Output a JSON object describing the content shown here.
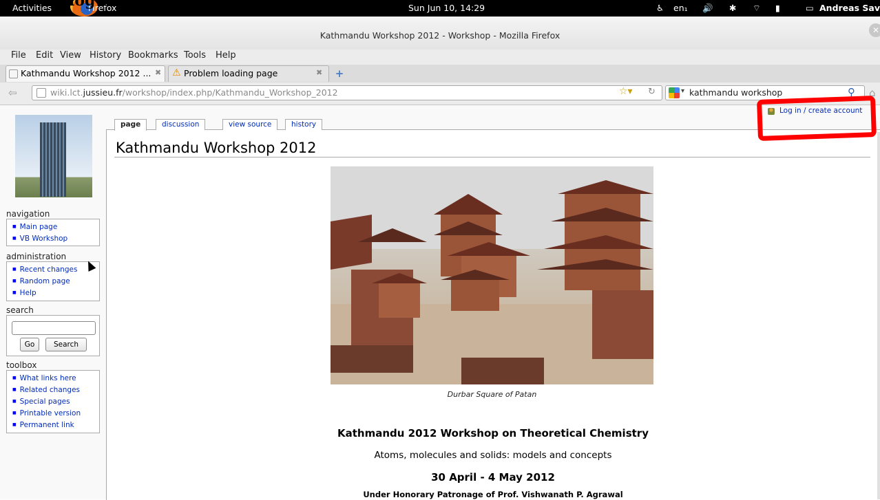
{
  "annotation": "log in",
  "top_panel": {
    "activities": "Activities",
    "app": "Firefox",
    "clock": "Sun Jun 10, 14:29",
    "keyboard": "en₁",
    "user": "Andreas Savin",
    "icons": [
      "accessibility-icon",
      "volume-icon",
      "bluetooth-icon",
      "wifi-icon",
      "battery-icon",
      "chat-icon"
    ]
  },
  "window": {
    "title": "Kathmandu Workshop 2012 - Workshop - Mozilla Firefox"
  },
  "menu": [
    "File",
    "Edit",
    "View",
    "History",
    "Bookmarks",
    "Tools",
    "Help"
  ],
  "tabs": [
    {
      "label": "Kathmandu Workshop 2012 ...",
      "active": true
    },
    {
      "label": "Problem loading page",
      "active": false
    }
  ],
  "nav": {
    "url_prefix": "wiki.lct.",
    "url_domain": "jussieu.fr",
    "url_path": "/workshop/index.php/Kathmandu_Workshop_2012",
    "search_value": "kathmandu workshop"
  },
  "sidebar": {
    "navigation": {
      "title": "navigation",
      "items": [
        "Main page",
        "VB Workshop"
      ]
    },
    "administration": {
      "title": "administration",
      "items": [
        "Recent changes",
        "Random page",
        "Help"
      ]
    },
    "search": {
      "title": "search",
      "go": "Go",
      "search": "Search"
    },
    "toolbox": {
      "title": "toolbox",
      "items": [
        "What links here",
        "Related changes",
        "Special pages",
        "Printable version",
        "Permanent link"
      ]
    }
  },
  "page_tabs": [
    "page",
    "discussion",
    "view source",
    "history"
  ],
  "login": "Log in / create account",
  "content": {
    "title": "Kathmandu Workshop 2012",
    "caption": "Durbar Square of Patan",
    "heading": "Kathmandu 2012 Workshop on Theoretical Chemistry",
    "subtitle": "Atoms, molecules and solids: models and concepts",
    "dates": "30 April - 4 May 2012",
    "patronage": "Under Honorary Patronage of Prof. Vishwanath P. Agrawal"
  }
}
